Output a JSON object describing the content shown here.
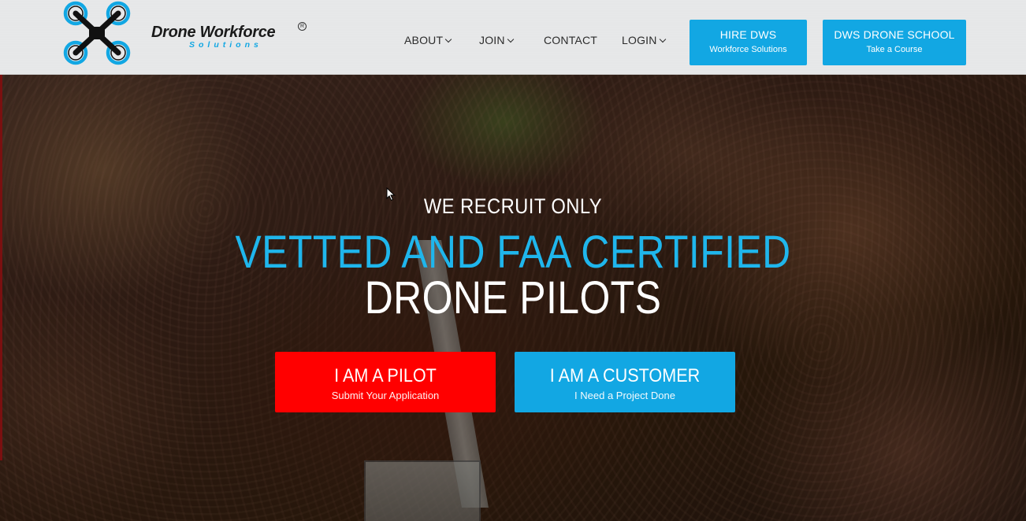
{
  "brand": {
    "name": "Drone Workforce",
    "sub": "Solutions",
    "registered": "R",
    "colors": {
      "accent": "#12a7e3",
      "headline_blue": "#1fb6ec",
      "pilot_red": "#ff0000"
    }
  },
  "nav": {
    "items": [
      {
        "label": "ABOUT",
        "has_dropdown": true
      },
      {
        "label": "JOIN",
        "has_dropdown": true
      },
      {
        "label": "CONTACT",
        "has_dropdown": false
      },
      {
        "label": "LOGIN",
        "has_dropdown": true
      }
    ]
  },
  "header_ctas": [
    {
      "title": "HIRE DWS",
      "subtitle": "Workforce Solutions"
    },
    {
      "title": "DWS DRONE SCHOOL",
      "subtitle": "Take a Course"
    }
  ],
  "hero": {
    "pre": "WE RECRUIT ONLY",
    "headline_line1": "VETTED AND FAA CERTIFIED",
    "headline_line2": "DRONE PILOTS",
    "ctas": [
      {
        "title": "I AM A PILOT",
        "subtitle": "Submit Your Application"
      },
      {
        "title": "I AM A CUSTOMER",
        "subtitle": "I Need a Project Done"
      }
    ]
  },
  "icons": [
    "drone-logo-icon",
    "chevron-down-icon",
    "mouse-cursor-icon"
  ]
}
